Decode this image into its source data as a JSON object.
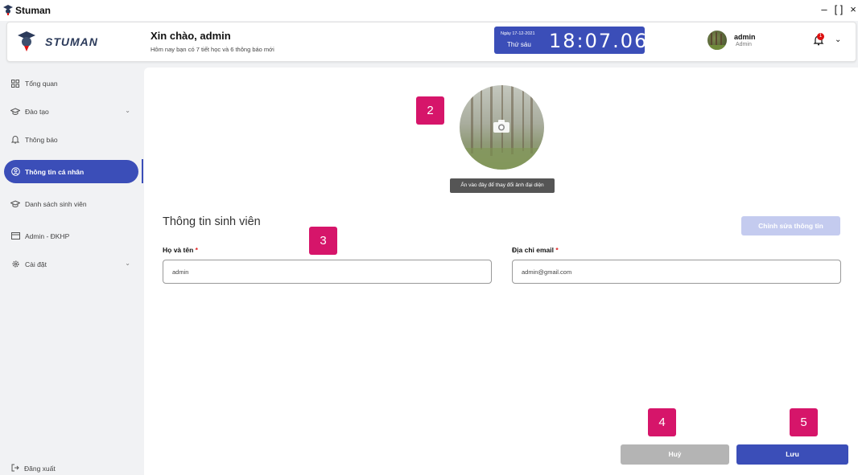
{
  "window": {
    "title": "Stuman",
    "controls": [
      "–",
      "[ ]",
      "×"
    ]
  },
  "header": {
    "logo_text": "STUMAN",
    "greeting": "Xin chào,  admin",
    "subgreeting": "Hôm nay bạn có 7 tiết học và 6 thông báo mới",
    "clock": {
      "date": "Ngày 17-12-2021",
      "day": "Thứ sáu",
      "time": "18:07.06"
    },
    "user": {
      "name": "admin",
      "role": "Admin"
    },
    "notification_count": "1"
  },
  "sidebar": {
    "items": [
      {
        "label": "Tổng quan",
        "icon": "grid-icon"
      },
      {
        "label": "Đào tạo",
        "icon": "graduation-cap-icon"
      },
      {
        "label": "Thông báo",
        "icon": "bell-icon"
      },
      {
        "label": "Thông tin cá nhân",
        "icon": "user-circle-icon"
      },
      {
        "label": "Danh sách sinh viên",
        "icon": "graduation-cap-icon"
      },
      {
        "label": "Admin - ĐKHP",
        "icon": "card-icon"
      },
      {
        "label": "Cài đặt",
        "icon": "gear-icon"
      }
    ],
    "logout": "Đăng xuất"
  },
  "profile": {
    "avatar_tooltip": "Ấn vào đây để thay đổi ảnh đại diện",
    "section_title": "Thông tin sinh viên",
    "edit_button": "Chỉnh sửa thông tin",
    "name_label": "Họ và tên",
    "name_value": "admin",
    "email_label": "Địa chỉ email",
    "email_value": "admin@gmail.com",
    "required_mark": "*",
    "cancel_button": "Huỷ",
    "save_button": "Lưu"
  },
  "markers": [
    "2",
    "3",
    "4",
    "5"
  ],
  "colors": {
    "primary": "#3b4eb8",
    "marker": "#d6156a",
    "disabled": "#c4cbef",
    "cancel": "#b4b4b4"
  }
}
